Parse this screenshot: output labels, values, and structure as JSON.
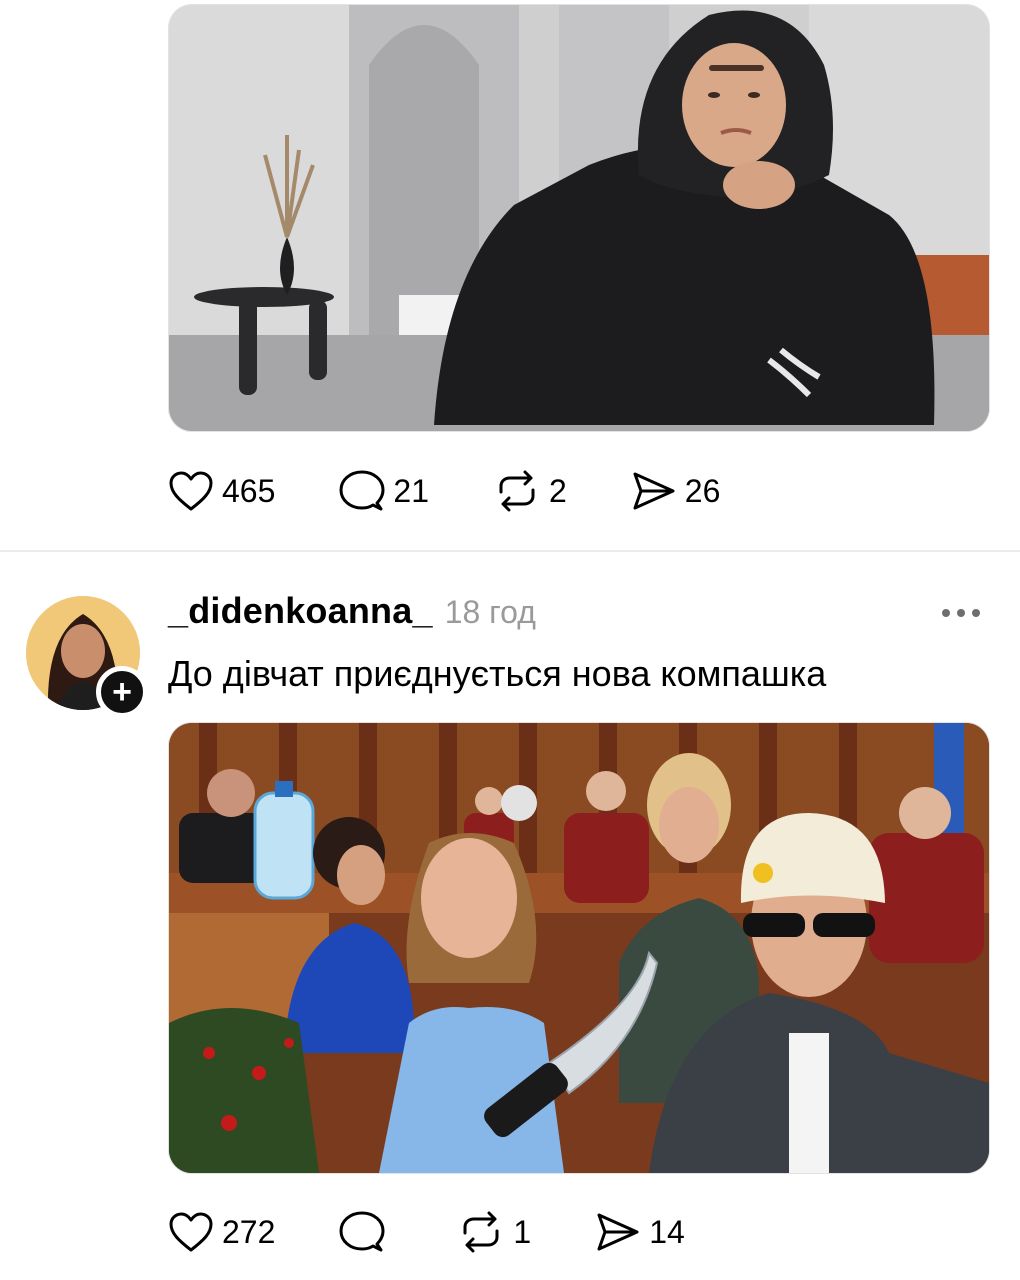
{
  "post1": {
    "stats": {
      "likes": "465",
      "replies": "21",
      "reposts": "2",
      "shares": "26"
    }
  },
  "post2": {
    "username": "_didenkoanna_",
    "timestamp": "18 год",
    "text": "До дівчат приєднується нова компашка",
    "follow_label": "+",
    "stats": {
      "likes": "272",
      "replies": "",
      "reposts": "1",
      "shares": "14"
    }
  },
  "icons": {
    "like": "heart-icon",
    "reply": "speech-bubble-icon",
    "repost": "repost-arrows-icon",
    "share": "paper-plane-icon",
    "more": "ellipsis-icon",
    "follow": "plus-icon"
  },
  "colors": {
    "text": "#000000",
    "muted": "#9a9a9a",
    "divider": "#ececec",
    "background": "#ffffff"
  }
}
